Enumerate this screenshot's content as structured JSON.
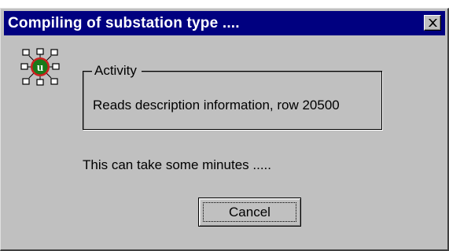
{
  "dialog": {
    "title": "Compiling of substation type ....",
    "close_icon": "close-x-icon",
    "app_icon": "substation-u-icon",
    "activity": {
      "legend": "Activity",
      "status": "Reads description information, row 20500"
    },
    "info": "This can take some minutes .....",
    "cancel_label": "Cancel"
  },
  "colors": {
    "titlebar": "#000080",
    "dialog_bg": "#c0c0c0",
    "icon_green": "#1a7a1a",
    "icon_red": "#cc2020"
  }
}
